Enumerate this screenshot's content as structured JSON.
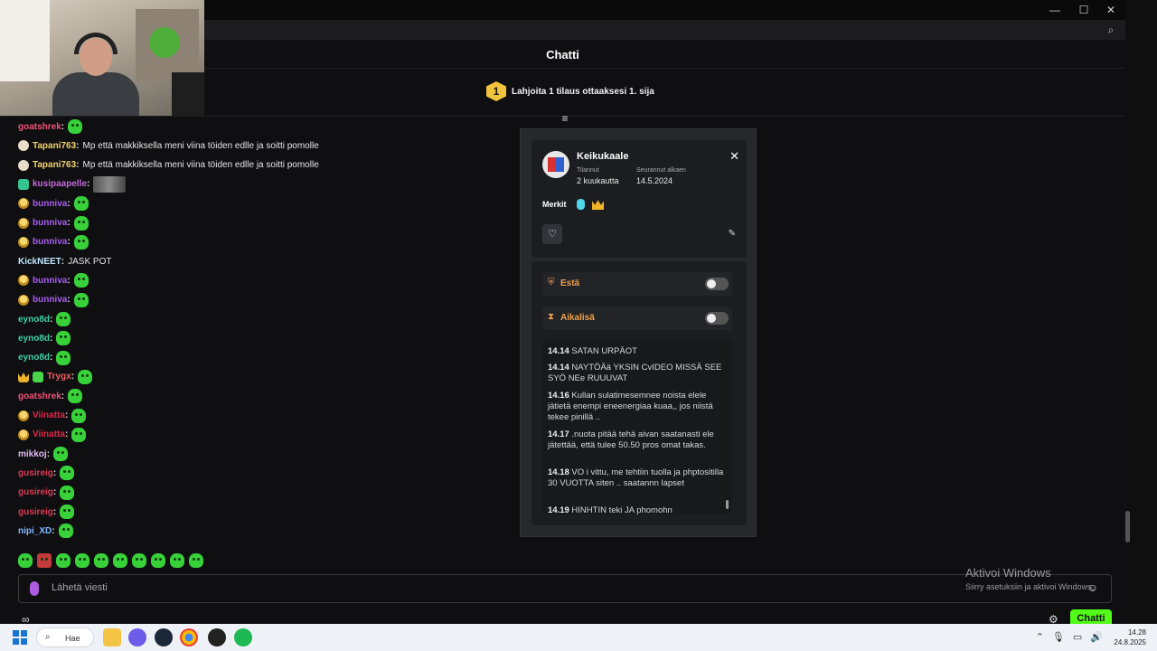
{
  "window": {
    "minimize": "—",
    "maximize": "☐",
    "close": "✕"
  },
  "header": {
    "title": "Chatti"
  },
  "goal": {
    "badge": "1",
    "text": "Lahjoita 1 tilaus ottaaksesi 1. sija"
  },
  "messages": [
    {
      "user": "goatshrek",
      "color": "#f2527a",
      "badges": [],
      "text": "",
      "emote": true
    },
    {
      "user": "Tapani763",
      "color": "#f3d26e",
      "badges": [
        "cup"
      ],
      "text": "Mp että makkiksella meni viina töiden edlle ja soitti pomolle",
      "emote": false
    },
    {
      "user": "Tapani763",
      "color": "#f3d26e",
      "badges": [
        "cup"
      ],
      "text": "Mp että makkiksella meni viina töiden edlle ja soitti pomolle",
      "emote": false
    },
    {
      "user": "kusipaapelle",
      "color": "#c46ad8",
      "badges": [
        "gift"
      ],
      "text": "",
      "emote": false,
      "image": true
    },
    {
      "user": "bunniva",
      "color": "#a85cf0",
      "badges": [
        "sub"
      ],
      "text": "",
      "emote": true
    },
    {
      "user": "bunniva",
      "color": "#a85cf0",
      "badges": [
        "sub"
      ],
      "text": "",
      "emote": true
    },
    {
      "user": "bunniva",
      "color": "#a85cf0",
      "badges": [
        "sub"
      ],
      "text": "",
      "emote": true
    },
    {
      "user": "KickNEET",
      "color": "#bfe7ff",
      "badges": [],
      "text": "JASK POT",
      "emote": false
    },
    {
      "user": "bunniva",
      "color": "#a85cf0",
      "badges": [
        "sub"
      ],
      "text": "",
      "emote": true
    },
    {
      "user": "bunniva",
      "color": "#a85cf0",
      "badges": [
        "sub"
      ],
      "text": "",
      "emote": true
    },
    {
      "user": "eyno8d",
      "color": "#3fd0a8",
      "badges": [],
      "text": "",
      "emote": true
    },
    {
      "user": "eyno8d",
      "color": "#3fd0a8",
      "badges": [],
      "text": "",
      "emote": true
    },
    {
      "user": "eyno8d",
      "color": "#3fd0a8",
      "badges": [],
      "text": "",
      "emote": true
    },
    {
      "user": "Trygx",
      "color": "#f25c5c",
      "badges": [
        "crown",
        "green"
      ],
      "text": "",
      "emote": true
    },
    {
      "user": "goatshrek",
      "color": "#f2527a",
      "badges": [],
      "text": "",
      "emote": true
    },
    {
      "user": "Viinatta",
      "color": "#e0274a",
      "badges": [
        "sub"
      ],
      "text": "",
      "emote": true
    },
    {
      "user": "Viinatta",
      "color": "#e0274a",
      "badges": [
        "sub"
      ],
      "text": "",
      "emote": true
    },
    {
      "user": "mikkoj",
      "color": "#e0b8f5",
      "badges": [],
      "text": "",
      "emote": true
    },
    {
      "user": "gusireig",
      "color": "#d93b55",
      "badges": [],
      "text": "",
      "emote": true
    },
    {
      "user": "gusireig",
      "color": "#d93b55",
      "badges": [],
      "text": "",
      "emote": true
    },
    {
      "user": "gusireig",
      "color": "#d93b55",
      "badges": [],
      "text": "",
      "emote": true
    },
    {
      "user": "nipi_XD",
      "color": "#7fb6ff",
      "badges": [],
      "text": "",
      "emote": true
    }
  ],
  "input": {
    "placeholder": "Lähetä viesti",
    "emote_icon": "☺",
    "gear": "⚙",
    "send_label": "Chatti",
    "bottom_icon": "∞"
  },
  "activation": {
    "line1": "Aktivoi Windows",
    "line2": "Siirry asetuksiin ja aktivoi Windows."
  },
  "user_card": {
    "name": "Keikukaale",
    "subscribed_label": "Tilannut",
    "subscribed_value": "2 kuukautta",
    "followed_label": "Seurannut alkaen",
    "followed_value": "14.5.2024",
    "close": "✕",
    "badges_label": "Merkit",
    "block_label": "Estä",
    "timeout_label": "Aikalisä",
    "log": [
      {
        "time": "14.14",
        "text": "SATAN URPÄOT"
      },
      {
        "time": "14.14",
        "text": "NAYTÖÄä YKSIN CvIDEO MISSÄ SEE SYÖ NEe RUUUVAT"
      },
      {
        "time": "14.16",
        "text": "Kullan sulatimesemnee noista elele jätietä enempi eneenergiaa kuaa,, jos niistä tekee pinillä .."
      },
      {
        "time": "14.17",
        "text": ".nuota pitää tehä aivan saatanasti ele jätettää, että tulee 50.50 pros omat takas."
      },
      {
        "time": "14.18",
        "text": "VO i vittu, me tehtiin tuolla ja phptositilla 30 VUOTTA siten .. saatannn lapset"
      },
      {
        "time": "14.19",
        "text": "HINHTIN teki JA phomohn"
      }
    ]
  },
  "taskbar": {
    "search_label": "Hae",
    "time": "14.28",
    "date": "24.8.2025"
  },
  "colors": {
    "accent": "#53fc18",
    "warning": "#f0a04b"
  }
}
